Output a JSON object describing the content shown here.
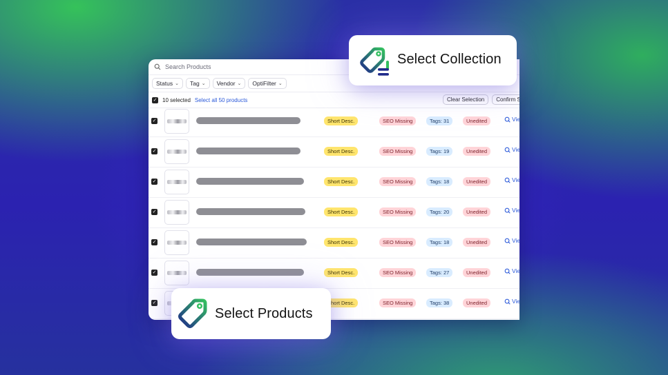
{
  "search": {
    "placeholder": "Search Products"
  },
  "filters": [
    {
      "label": "Status"
    },
    {
      "label": "Tag"
    },
    {
      "label": "Vendor"
    },
    {
      "label": "OptiFilter"
    }
  ],
  "selection": {
    "count_label": "10 selected",
    "select_all_label": "Select all 50 products",
    "clear_label": "Clear Selection",
    "confirm_label": "Confirm Selection"
  },
  "products": [
    {
      "short_desc": "Short Desc.",
      "seo": "SEO Missing",
      "tags": "Tags: 31",
      "status": "Unedited",
      "view": "View"
    },
    {
      "short_desc": "Short Desc.",
      "seo": "SEO Missing",
      "tags": "Tags: 19",
      "status": "Unedited",
      "view": "View"
    },
    {
      "short_desc": "Short Desc.",
      "seo": "SEO Missing",
      "tags": "Tags: 18",
      "status": "Unedited",
      "view": "View"
    },
    {
      "short_desc": "Short Desc.",
      "seo": "SEO Missing",
      "tags": "Tags: 20",
      "status": "Unedited",
      "view": "View"
    },
    {
      "short_desc": "Short Desc.",
      "seo": "SEO Missing",
      "tags": "Tags: 18",
      "status": "Unedited",
      "view": "View"
    },
    {
      "short_desc": "Short Desc.",
      "seo": "SEO Missing",
      "tags": "Tags: 27",
      "status": "Unedited",
      "view": "View"
    },
    {
      "short_desc": "Short Desc.",
      "seo": "SEO Missing",
      "tags": "Tags: 38",
      "status": "Unedited",
      "view": "View"
    }
  ],
  "cards": {
    "collection": {
      "title": "Select Collection",
      "icon": "collection-tag-icon"
    },
    "products": {
      "title": "Select Products",
      "icon": "product-tag-icon"
    }
  },
  "colors": {
    "short_desc_badge": "#ffe56d",
    "seo_badge": "#ffd4d8",
    "tags_badge": "#d9ecff",
    "link": "#2b59d9",
    "brand_green": "#34c060",
    "brand_navy": "#1f2a8a"
  }
}
